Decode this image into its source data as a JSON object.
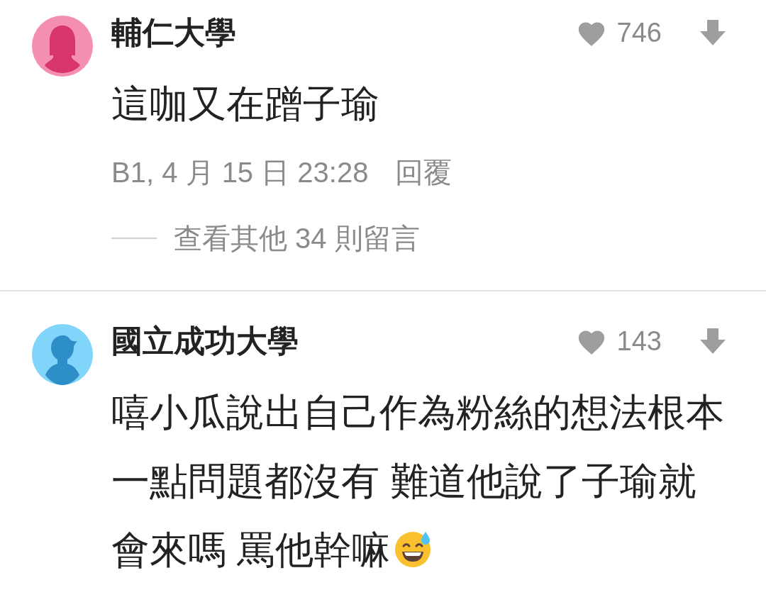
{
  "comments": [
    {
      "kind": "female",
      "color": "#f48fb1",
      "name": "輔仁大學",
      "likes": "746",
      "body": "這咖又在蹭子瑜",
      "meta": "B1, 4 月 15 日 23:28",
      "reply": "回覆",
      "more_replies": "查看其他 34 則留言",
      "emoji": false
    },
    {
      "kind": "male",
      "color": "#81d4fa",
      "name": "國立成功大學",
      "likes": "143",
      "body": "嘻小瓜說出自己作為粉絲的想法根本一點問題都沒有 難道他說了子瑜就會來嗎 罵他幹嘛",
      "emoji": true
    }
  ]
}
